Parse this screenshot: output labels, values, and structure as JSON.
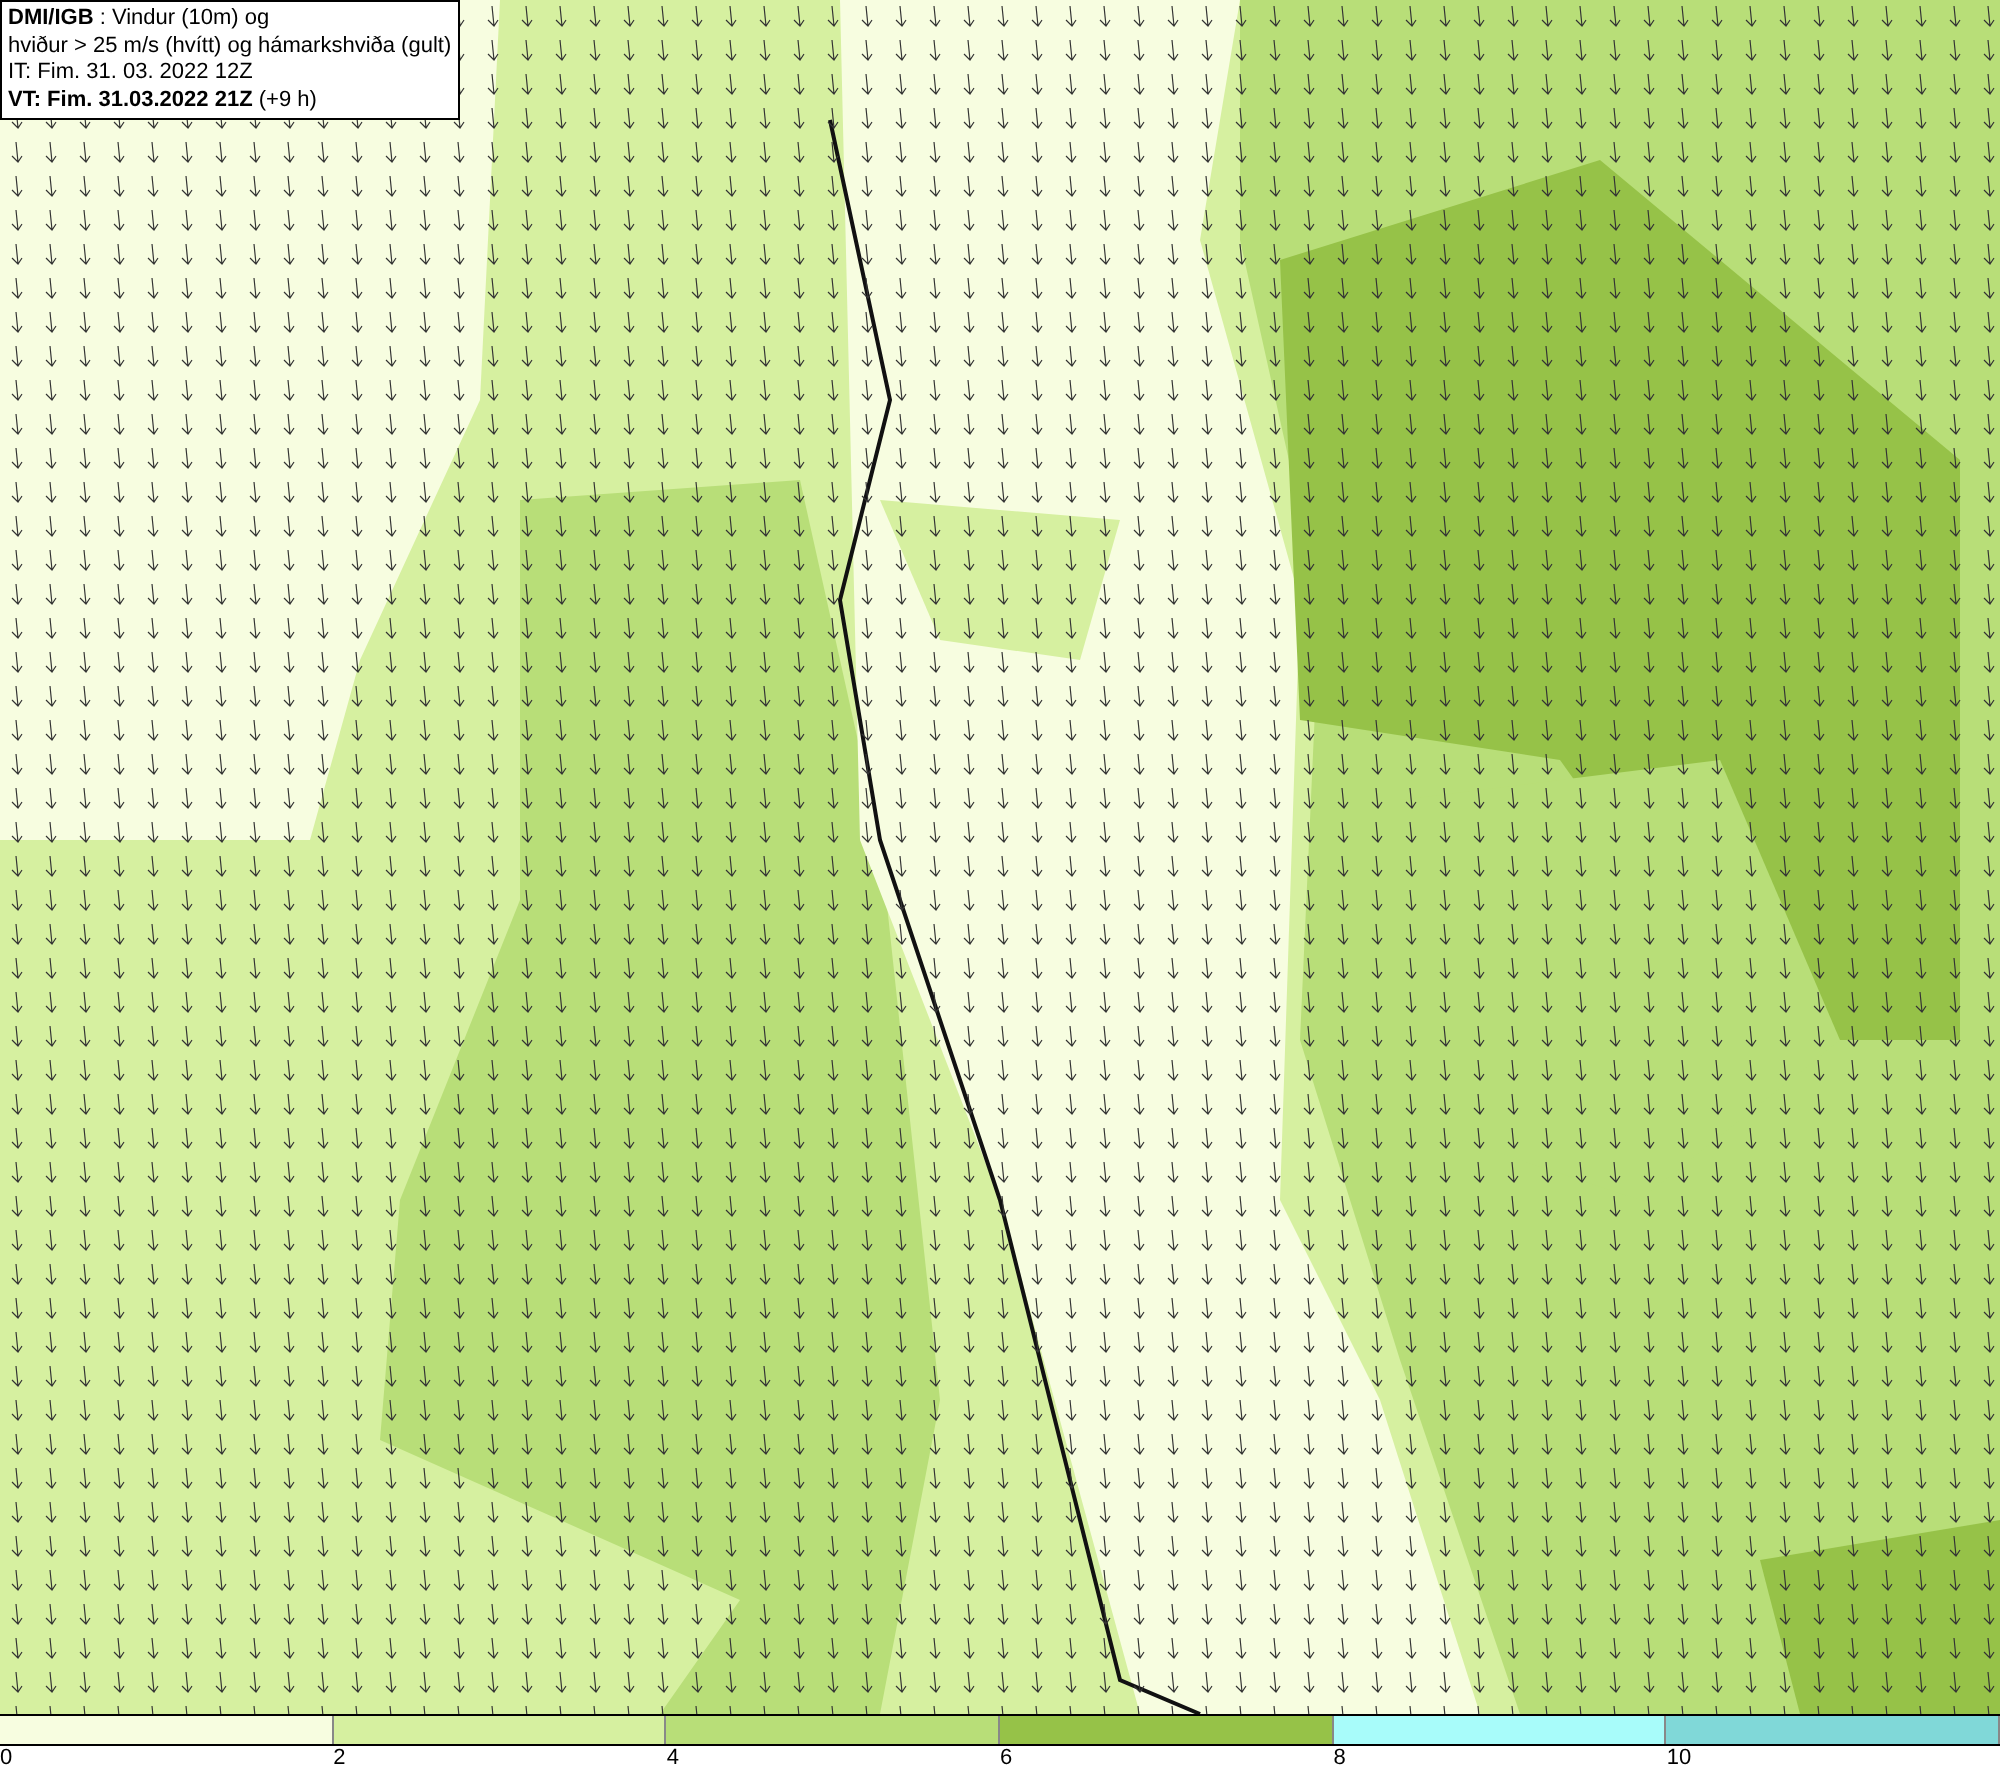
{
  "header": {
    "lines": [
      "**DMI/IGB** : Vindur (10m) og",
      "hviður > 25 m/s (hvítt) og hámarkshviða (gult)",
      "IT: Fim. 31. 03. 2022 12Z",
      "**VT: Fim. 31.03.2022 21Z** (+9 h)"
    ]
  },
  "legend": {
    "segments": [
      {
        "color": "#f7fde0"
      },
      {
        "color": "#d6f0a0"
      },
      {
        "color": "#b8de78"
      },
      {
        "color": "#96c248"
      },
      {
        "color": "#a8fcfa"
      },
      {
        "color": "#80d8d8"
      }
    ],
    "ticks": [
      "0",
      "2",
      "4",
      "6",
      "8",
      "10"
    ]
  }
}
